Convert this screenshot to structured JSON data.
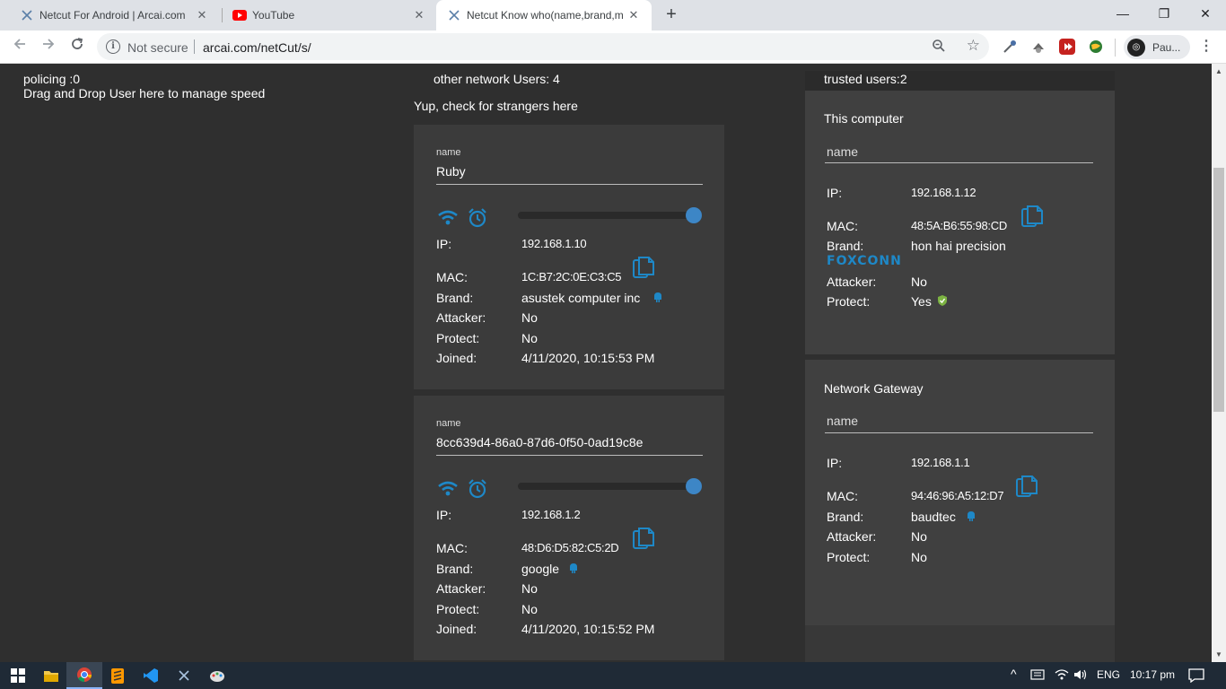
{
  "browser": {
    "tabs": [
      {
        "title": "Netcut For Android | Arcai.com",
        "close": "✕"
      },
      {
        "title": "YouTube",
        "close": "✕"
      },
      {
        "title": "Netcut Know who(name,brand,m",
        "close": "✕"
      }
    ],
    "new_tab": "+",
    "window_controls": {
      "minimize": "—",
      "maximize": "❐",
      "close": "✕"
    },
    "security_label": "Not secure",
    "url": "arcai.com/netCut/s/",
    "profile_name": "Pau..."
  },
  "page": {
    "policing": "policing :0",
    "drag_drop": "Drag and Drop User here to manage speed",
    "other_users": "other network Users: 4",
    "strangers_hint": "Yup, check for strangers here",
    "trusted_users": "trusted users:2"
  },
  "labels": {
    "name": "name",
    "ip": "IP:",
    "mac": "MAC:",
    "brand": "Brand:",
    "attacker": "Attacker:",
    "protect": "Protect:",
    "joined": "Joined:"
  },
  "users": [
    {
      "name": "Ruby",
      "ip": "192.168.1.10",
      "mac": "1C:B7:2C:0E:C3:C5",
      "brand": "asustek computer inc",
      "attacker": "No",
      "protect": "No",
      "joined": "4/11/2020, 10:15:53 PM",
      "speed_fraction": 1.0
    },
    {
      "name": "8cc639d4-86a0-87d6-0f50-0ad19c8e",
      "ip": "192.168.1.2",
      "mac": "48:D6:D5:82:C5:2D",
      "brand": "google",
      "attacker": "No",
      "protect": "No",
      "joined": "4/11/2020, 10:15:52 PM",
      "speed_fraction": 1.0
    }
  ],
  "this_computer": {
    "title": "This computer",
    "name_placeholder": "name",
    "ip": "192.168.1.12",
    "mac": "48:5A:B6:55:98:CD",
    "brand": "hon hai precision",
    "logo_text": "FOXCONN",
    "attacker": "No",
    "protect": "Yes"
  },
  "gateway": {
    "title": "Network Gateway",
    "name_placeholder": "name",
    "ip": "192.168.1.1",
    "mac": "94:46:96:A5:12:D7",
    "brand": "baudtec",
    "attacker": "No",
    "protect": "No"
  },
  "taskbar": {
    "tray_up": "^",
    "lang": "ENG",
    "time": "10:17 pm"
  },
  "colors": {
    "accent_blue": "#1e88c7",
    "card_bg": "#3b3b3b",
    "page_bg": "#2f2f2f"
  }
}
